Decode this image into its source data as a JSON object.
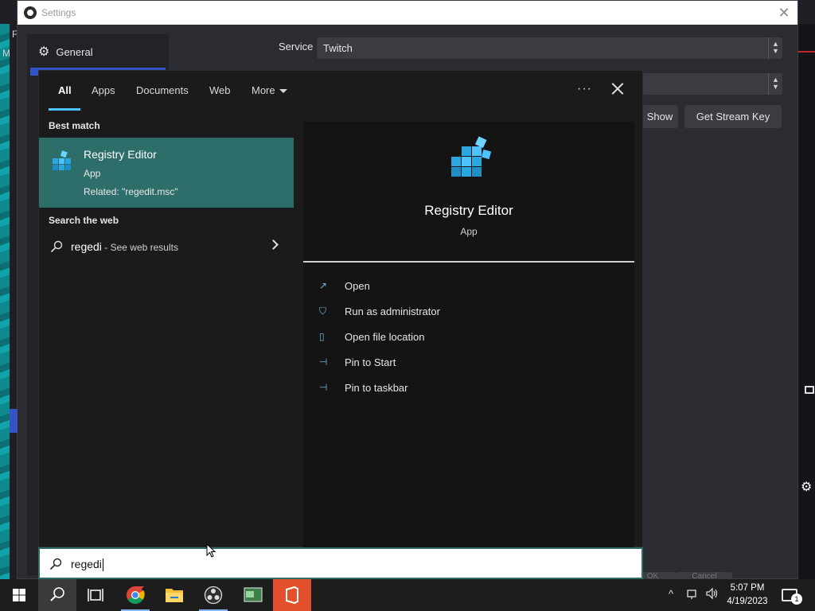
{
  "background_app": {
    "window_title": "Settings",
    "left_fragments": [
      "F",
      "M"
    ],
    "sidebar": {
      "general_label": "General"
    },
    "service_label": "Service",
    "service_value": "Twitch",
    "show_button_label": "Show",
    "stream_key_button_label": "Get Stream Key",
    "bottom_buttons": [
      "OK",
      "Cancel"
    ]
  },
  "search": {
    "tabs": [
      {
        "label": "All",
        "active": true
      },
      {
        "label": "Apps",
        "active": false
      },
      {
        "label": "Documents",
        "active": false
      },
      {
        "label": "Web",
        "active": false
      },
      {
        "label": "More",
        "active": false
      }
    ],
    "options_label": "···",
    "best_match_title": "Best match",
    "best_match": {
      "name": "Registry Editor",
      "type": "App",
      "related": "Related: \"regedit.msc\""
    },
    "web_title": "Search the web",
    "web_result": {
      "query": "regedi",
      "suffix": " - See web results"
    },
    "preview": {
      "name": "Registry Editor",
      "type": "App",
      "actions": [
        {
          "label": "Open",
          "icon": "open-icon"
        },
        {
          "label": "Run as administrator",
          "icon": "shield-icon"
        },
        {
          "label": "Open file location",
          "icon": "file-location-icon"
        },
        {
          "label": "Pin to Start",
          "icon": "pin-icon"
        },
        {
          "label": "Pin to taskbar",
          "icon": "pin-icon"
        }
      ]
    },
    "query": "regedi"
  },
  "taskbar": {
    "apps": [
      "start-button",
      "search-button",
      "task-view-button",
      "chrome-icon",
      "file-explorer-icon",
      "obs-icon",
      "registry-app-icon",
      "office-icon"
    ],
    "time": "5:07 PM",
    "date": "4/19/2023",
    "notification_count": "1"
  },
  "colors": {
    "accent": "#4cc2ff",
    "best_match_bg": "#2e6e6a",
    "obs_selection": "#3454c4"
  }
}
